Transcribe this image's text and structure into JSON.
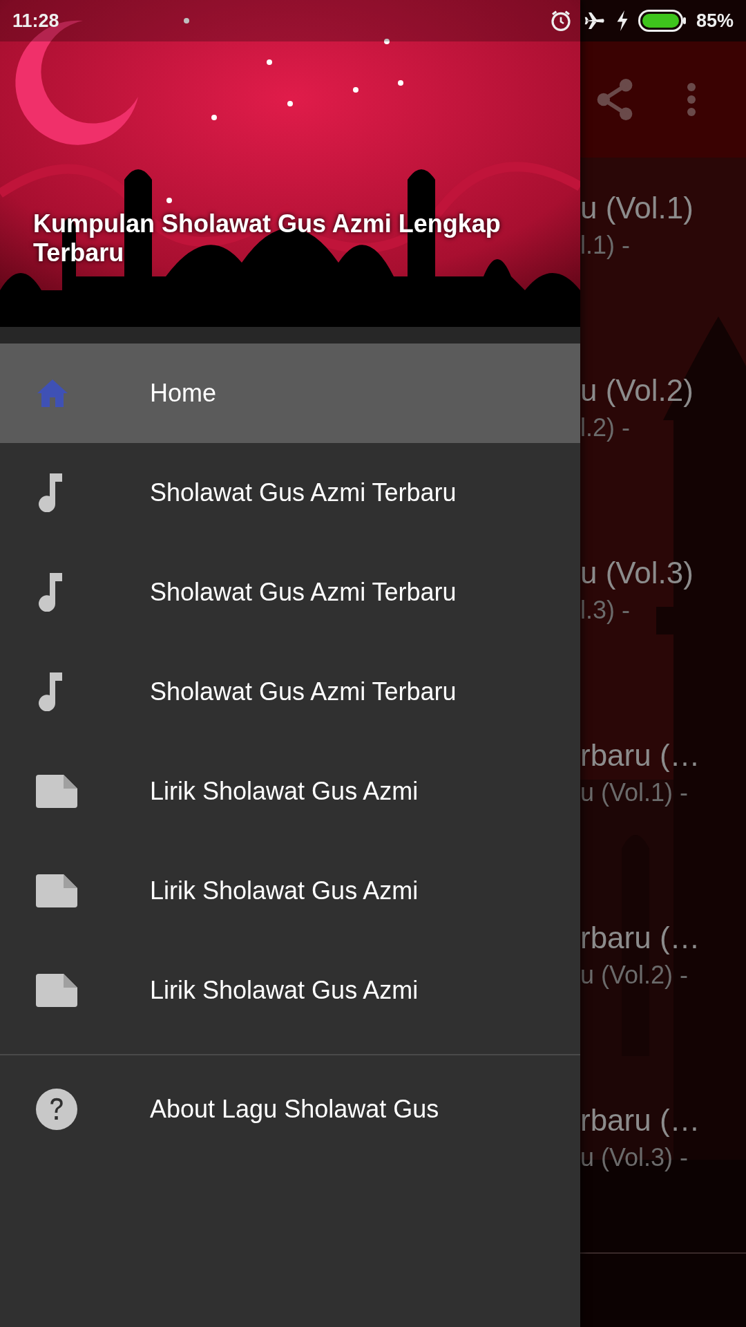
{
  "status_bar": {
    "time": "11:28",
    "battery": "85%"
  },
  "drawer": {
    "header_title": "Kumpulan Sholawat Gus Azmi Lengkap Terbaru",
    "items": [
      {
        "label": "Home",
        "kind": "home",
        "selected": true
      },
      {
        "label": "Sholawat Gus Azmi Terbaru",
        "kind": "music",
        "selected": false
      },
      {
        "label": "Sholawat Gus Azmi Terbaru",
        "kind": "music",
        "selected": false
      },
      {
        "label": "Sholawat Gus Azmi Terbaru",
        "kind": "music",
        "selected": false
      },
      {
        "label": "Lirik Sholawat Gus Azmi",
        "kind": "document",
        "selected": false
      },
      {
        "label": "Lirik Sholawat Gus Azmi",
        "kind": "document",
        "selected": false
      },
      {
        "label": "Lirik Sholawat Gus Azmi",
        "kind": "document",
        "selected": false
      }
    ],
    "footer_items": [
      {
        "label": "About Lagu Sholawat Gus",
        "kind": "help",
        "selected": false
      }
    ]
  },
  "list": [
    {
      "title": "u (Vol.1)",
      "subtitle": "l.1) -"
    },
    {
      "title": "u (Vol.2)",
      "subtitle": "l.2) -"
    },
    {
      "title": "u (Vol.3)",
      "subtitle": "l.3) -"
    },
    {
      "title": "rbaru (…",
      "subtitle": "u (Vol.1) -"
    },
    {
      "title": "rbaru (…",
      "subtitle": "u (Vol.2) -"
    },
    {
      "title": "rbaru (…",
      "subtitle": "u (Vol.3) -"
    }
  ]
}
